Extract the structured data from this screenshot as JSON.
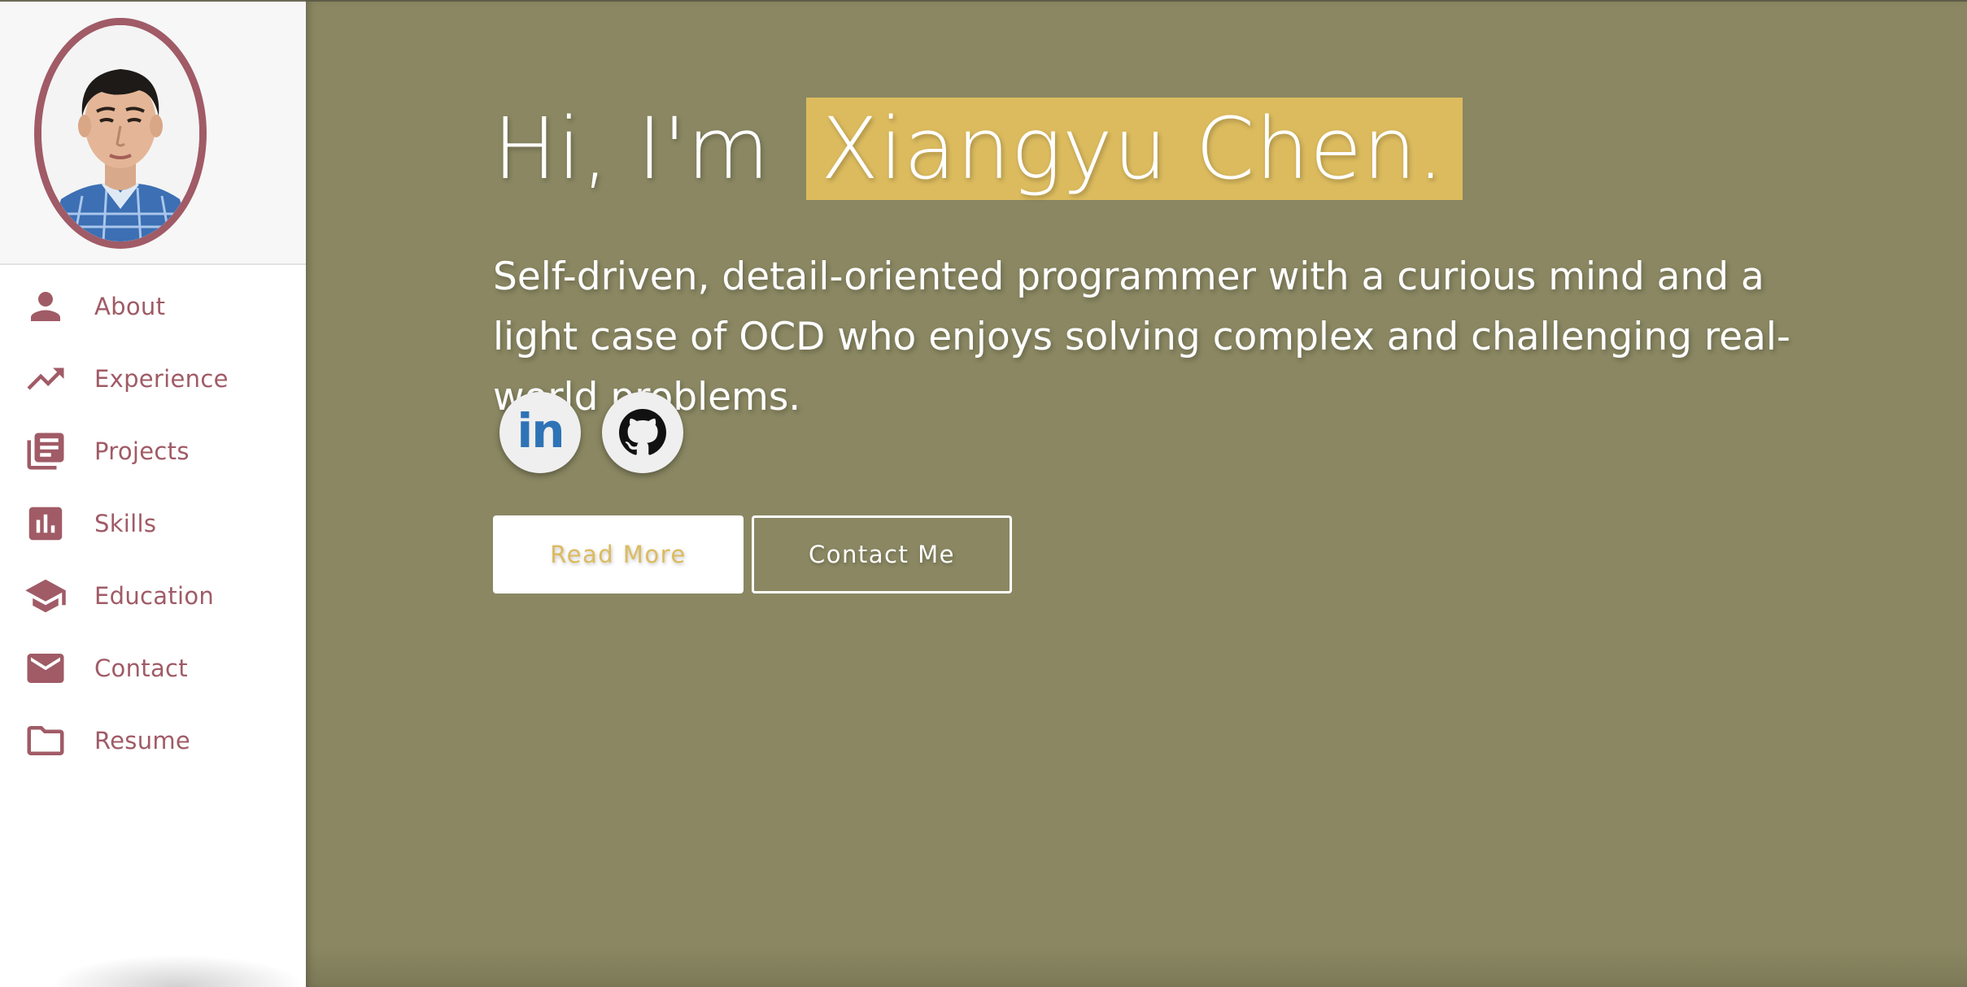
{
  "sidebar": {
    "avatar_alt": "profile photo",
    "items": [
      {
        "label": "About",
        "icon": "person-icon"
      },
      {
        "label": "Experience",
        "icon": "trending-up-icon"
      },
      {
        "label": "Projects",
        "icon": "library-books-icon"
      },
      {
        "label": "Skills",
        "icon": "bar-chart-icon"
      },
      {
        "label": "Education",
        "icon": "graduation-cap-icon"
      },
      {
        "label": "Contact",
        "icon": "mail-icon"
      },
      {
        "label": "Resume",
        "icon": "folder-icon"
      }
    ]
  },
  "hero": {
    "greeting": "Hi, I'm",
    "name": "Xiangyu Chen.",
    "tagline": "Self-driven, detail-oriented programmer with a curious mind and a light case of OCD who enjoys solving complex and challenging real-world problems.",
    "social": [
      {
        "label": "in",
        "icon": "linkedin-icon"
      },
      {
        "label": "",
        "icon": "github-icon"
      }
    ],
    "read_more_label": "Read More",
    "contact_label": "Contact Me"
  },
  "colors": {
    "accent": "#a05b66",
    "hero_bg": "#8a8762",
    "highlight": "#dcbb5e",
    "linkedin_blue": "#2e73b6"
  }
}
